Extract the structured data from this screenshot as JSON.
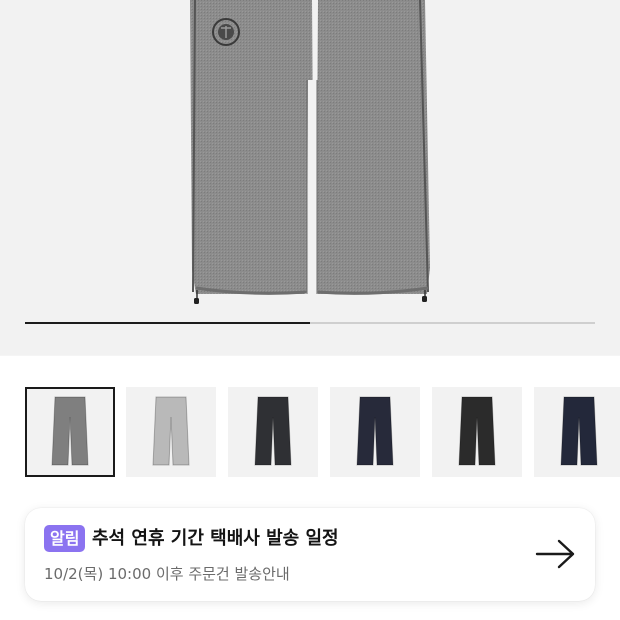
{
  "gallery": {
    "progress": 0.5,
    "thumbnails": [
      {
        "name": "thumb-gray",
        "color": "#7f7f7f",
        "selected": true
      },
      {
        "name": "thumb-light-gray",
        "color": "#b9b9b9",
        "selected": false
      },
      {
        "name": "thumb-charcoal",
        "color": "#2f3034",
        "selected": false
      },
      {
        "name": "thumb-navy",
        "color": "#272a3a",
        "selected": false
      },
      {
        "name": "thumb-black",
        "color": "#2b2b2b",
        "selected": false
      },
      {
        "name": "thumb-dark-navy",
        "color": "#23283a",
        "selected": false
      }
    ]
  },
  "notice": {
    "badge": "알림",
    "title": "추석 연휴 기간 택배사 발송 일정",
    "subtitle": "10/2(목) 10:00 이후 주문건 발송안내",
    "arrow_icon": "arrow-right-icon"
  },
  "colors": {
    "badge": "#8b73f0",
    "pants_main": "#8a8a8a"
  }
}
